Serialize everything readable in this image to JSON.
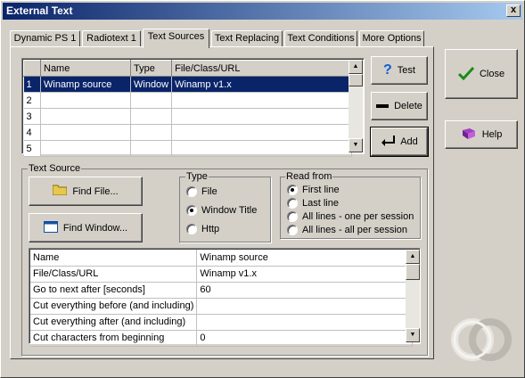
{
  "window": {
    "title": "External Text",
    "close_glyph": "x"
  },
  "tabs": [
    {
      "label": "Dynamic PS 1",
      "active": false
    },
    {
      "label": "Radiotext 1",
      "active": false
    },
    {
      "label": "Text Sources",
      "active": true
    },
    {
      "label": "Text Replacing",
      "active": false
    },
    {
      "label": "Text Conditions",
      "active": false
    },
    {
      "label": "More Options",
      "active": false
    }
  ],
  "sources_table": {
    "headers": [
      "",
      "Name",
      "Type",
      "File/Class/URL"
    ],
    "rows": [
      {
        "num": "1",
        "name": "Winamp source",
        "type": "Window",
        "url": "Winamp v1.x",
        "selected": true
      },
      {
        "num": "2",
        "name": "",
        "type": "",
        "url": "",
        "selected": false
      },
      {
        "num": "3",
        "name": "",
        "type": "",
        "url": "",
        "selected": false
      },
      {
        "num": "4",
        "name": "",
        "type": "",
        "url": "",
        "selected": false
      },
      {
        "num": "5",
        "name": "",
        "type": "",
        "url": "",
        "selected": false
      }
    ]
  },
  "side_buttons": {
    "test": "Test",
    "delete": "Delete",
    "add": "Add"
  },
  "right_buttons": {
    "close": "Close",
    "help": "Help"
  },
  "text_source": {
    "legend": "Text Source",
    "find_file": "Find File...",
    "find_window": "Find Window...",
    "type_group": {
      "legend": "Type",
      "options": [
        {
          "label": "File",
          "checked": false
        },
        {
          "label": "Window Title",
          "checked": true
        },
        {
          "label": "Http",
          "checked": false
        }
      ]
    },
    "read_group": {
      "legend": "Read from",
      "options": [
        {
          "label": "First line",
          "checked": true
        },
        {
          "label": "Last line",
          "checked": false
        },
        {
          "label": "All lines - one per session",
          "checked": false
        },
        {
          "label": "All lines - all per session",
          "checked": false
        }
      ]
    },
    "properties": [
      {
        "key": "Name",
        "value": "Winamp source"
      },
      {
        "key": "File/Class/URL",
        "value": "Winamp v1.x"
      },
      {
        "key": "Go to next after [seconds]",
        "value": "60"
      },
      {
        "key": "Cut everything before (and including)",
        "value": ""
      },
      {
        "key": "Cut everything after (and including)",
        "value": ""
      },
      {
        "key": "Cut characters from beginning",
        "value": "0"
      }
    ]
  },
  "colors": {
    "face": "#d4d0c8",
    "selection": "#0a246a",
    "title_start": "#0a246a",
    "title_end": "#a6caf0"
  }
}
